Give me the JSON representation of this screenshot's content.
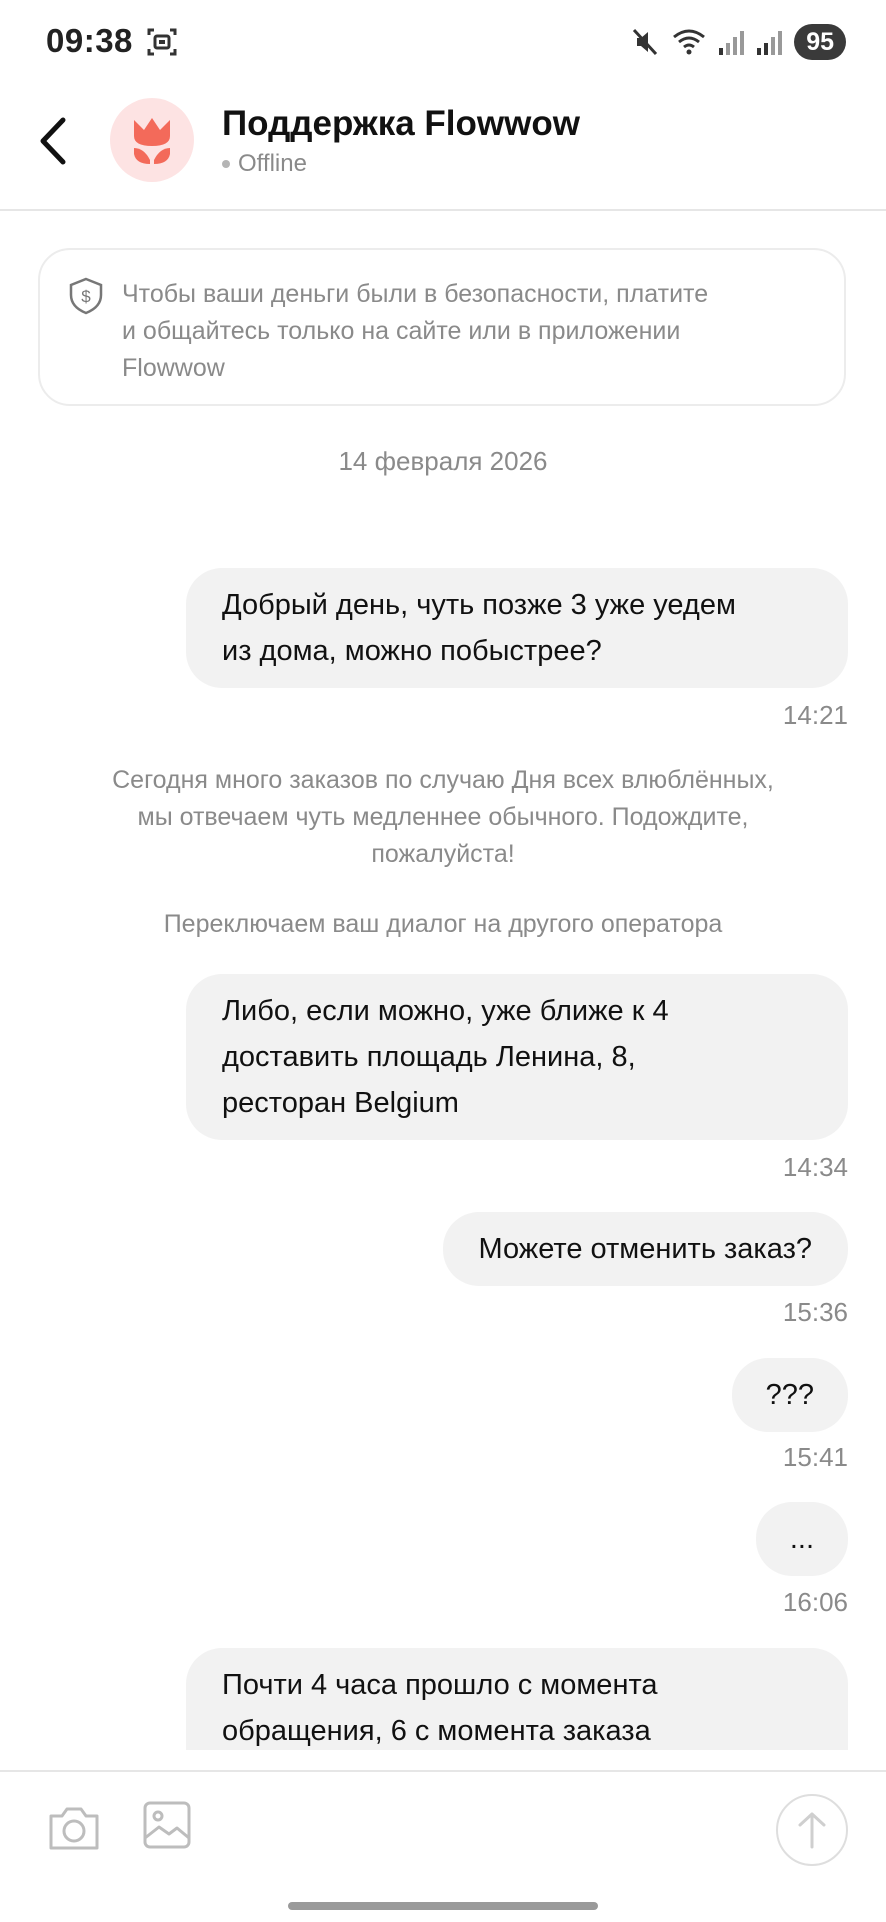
{
  "status_bar": {
    "time": "09:38",
    "battery": "95",
    "icons": [
      "screenshot-icon",
      "mute-icon",
      "wifi-icon",
      "signal-icon",
      "signal-icon"
    ]
  },
  "header": {
    "title": "Поддержка Flowwow",
    "status": "Offline",
    "avatar_icon": "tulip-icon",
    "accent_color": "#f36a5a"
  },
  "notice": {
    "icon": "shield-dollar-icon",
    "line1": "Чтобы ваши деньги были в безопасности, платите",
    "line2": "и общайтесь только на сайте или в приложении",
    "line3": "Flowwow"
  },
  "date_separator": "14 февраля 2026",
  "messages": [
    {
      "lines": [
        "Добрый день, чуть позже 3 уже уедем",
        "из дома, можно побыстрее?"
      ],
      "time": "14:21"
    },
    {
      "lines": [
        "Либо, если можно, уже ближе к 4",
        "доставить площадь Ленина, 8,",
        "ресторан Belgium"
      ],
      "time": "14:34"
    },
    {
      "lines": [
        "Можете отменить заказ?"
      ],
      "time": "15:36"
    },
    {
      "lines": [
        "???"
      ],
      "time": "15:41"
    },
    {
      "lines": [
        "..."
      ],
      "time": "16:06"
    },
    {
      "lines": [
        "Почти 4 часа прошло с момента",
        "обращения, 6 с момента заказа"
      ]
    }
  ],
  "system_messages": [
    {
      "lines": [
        "Сегодня много заказов по случаю Дня всех влюблённых,",
        "мы отвечаем чуть медленнее обычного. Подождите,",
        "пожалуйста!"
      ]
    },
    {
      "lines": [
        "Переключаем ваш диалог на другого оператора"
      ]
    }
  ],
  "bottom_bar": {
    "icons": [
      "camera-icon",
      "gallery-icon",
      "send-arrow-icon"
    ]
  }
}
